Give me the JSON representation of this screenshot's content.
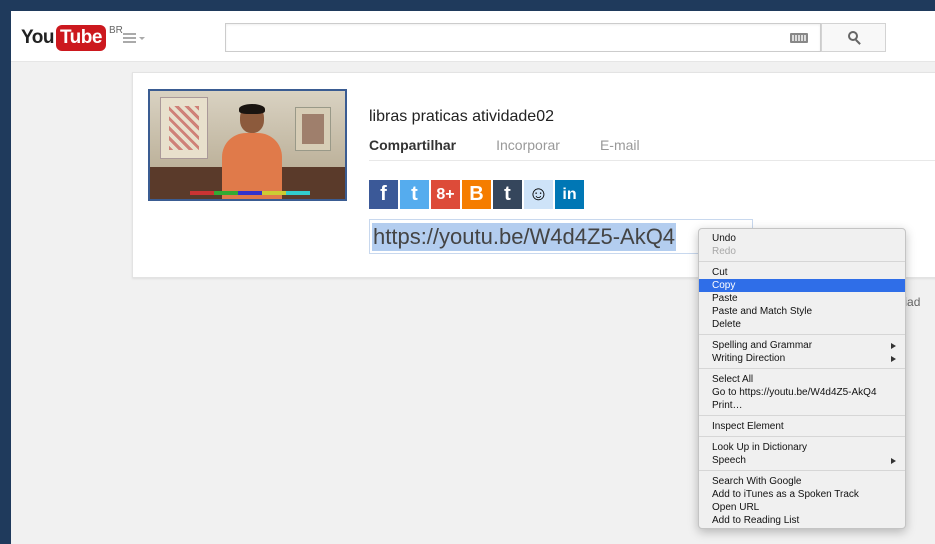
{
  "masthead": {
    "logo_you": "You",
    "logo_tube": "Tube",
    "logo_country": "BR",
    "search_placeholder": ""
  },
  "share": {
    "video_title": "libras praticas atividade02",
    "tabs": [
      {
        "label": "Compartilhar",
        "active": true
      },
      {
        "label": "Incorporar",
        "active": false
      },
      {
        "label": "E-mail",
        "active": false
      }
    ],
    "social": [
      {
        "name": "facebook",
        "glyph": "f"
      },
      {
        "name": "twitter",
        "glyph": "t"
      },
      {
        "name": "google-plus",
        "glyph": "8+"
      },
      {
        "name": "blogger",
        "glyph": "B"
      },
      {
        "name": "tumblr",
        "glyph": "t"
      },
      {
        "name": "reddit",
        "glyph": "☺"
      },
      {
        "name": "linkedin",
        "glyph": "in"
      }
    ],
    "url": "https://youtu.be/W4d4Z5-AkQ4"
  },
  "behind_text": "enciad",
  "context_menu": {
    "groups": [
      [
        {
          "label": "Undo",
          "disabled": false
        },
        {
          "label": "Redo",
          "disabled": true
        }
      ],
      [
        {
          "label": "Cut"
        },
        {
          "label": "Copy",
          "highlighted": true
        },
        {
          "label": "Paste"
        },
        {
          "label": "Paste and Match Style"
        },
        {
          "label": "Delete"
        }
      ],
      [
        {
          "label": "Spelling and Grammar",
          "submenu": true
        },
        {
          "label": "Writing Direction",
          "submenu": true
        }
      ],
      [
        {
          "label": "Select All"
        },
        {
          "label": "Go to https://youtu.be/W4d4Z5-AkQ4"
        },
        {
          "label": "Print…"
        }
      ],
      [
        {
          "label": "Inspect Element"
        }
      ],
      [
        {
          "label": "Look Up in Dictionary"
        },
        {
          "label": "Speech",
          "submenu": true
        }
      ],
      [
        {
          "label": "Search With Google"
        },
        {
          "label": "Add to iTunes as a Spoken Track"
        },
        {
          "label": "Open URL"
        },
        {
          "label": "Add to Reading List"
        }
      ]
    ]
  },
  "colors": {
    "frame": "#1f3a5c",
    "youtube_red": "#cc181e",
    "selection": "#b3cdef",
    "menu_highlight": "#2f6ee8"
  }
}
